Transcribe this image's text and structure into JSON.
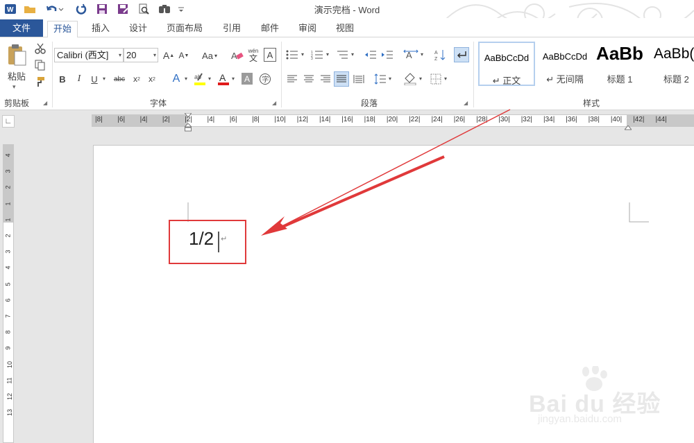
{
  "title": "演示完档 - Word",
  "tabs": [
    {
      "label": "文件"
    },
    {
      "label": "开始"
    },
    {
      "label": "插入"
    },
    {
      "label": "设计"
    },
    {
      "label": "页面布局"
    },
    {
      "label": "引用"
    },
    {
      "label": "邮件"
    },
    {
      "label": "审阅"
    },
    {
      "label": "视图"
    }
  ],
  "ribbon": {
    "clipboard": {
      "paste_label": "粘贴",
      "group_label": "剪贴板"
    },
    "font": {
      "font_name": "Calibri (西文]",
      "font_size": "20",
      "group_label": "字体",
      "change_case": "Aa",
      "phonetic": "wén\n文"
    },
    "paragraph": {
      "group_label": "段落"
    },
    "styles": {
      "group_label": "样式",
      "items": [
        {
          "sample": "AaBbCcDd",
          "name": "↵ 正文"
        },
        {
          "sample": "AaBbCcDd",
          "name": "↵ 无间隔"
        },
        {
          "sample": "AaBb",
          "name": "标题 1"
        },
        {
          "sample": "AaBb(",
          "name": "标题 2"
        }
      ]
    }
  },
  "ruler": {
    "labels": [
      "8",
      "6",
      "4",
      "2",
      "2",
      "4",
      "6",
      "8",
      "10",
      "12",
      "14",
      "16",
      "18",
      "20",
      "22",
      "24",
      "26",
      "28",
      "30",
      "32",
      "34",
      "36",
      "38",
      "40",
      "42",
      "44"
    ],
    "vertical_labels": [
      "4",
      "3",
      "2",
      "1",
      "1",
      "2",
      "3",
      "4",
      "5",
      "6",
      "7",
      "8",
      "9",
      "10",
      "11",
      "12",
      "13"
    ]
  },
  "document": {
    "content": "1/2"
  },
  "watermark": {
    "brand": "Bai du 经验",
    "url": "jingyan.baidu.com"
  },
  "colors": {
    "accent": "#2b579a",
    "annotation": "#e0393a"
  }
}
